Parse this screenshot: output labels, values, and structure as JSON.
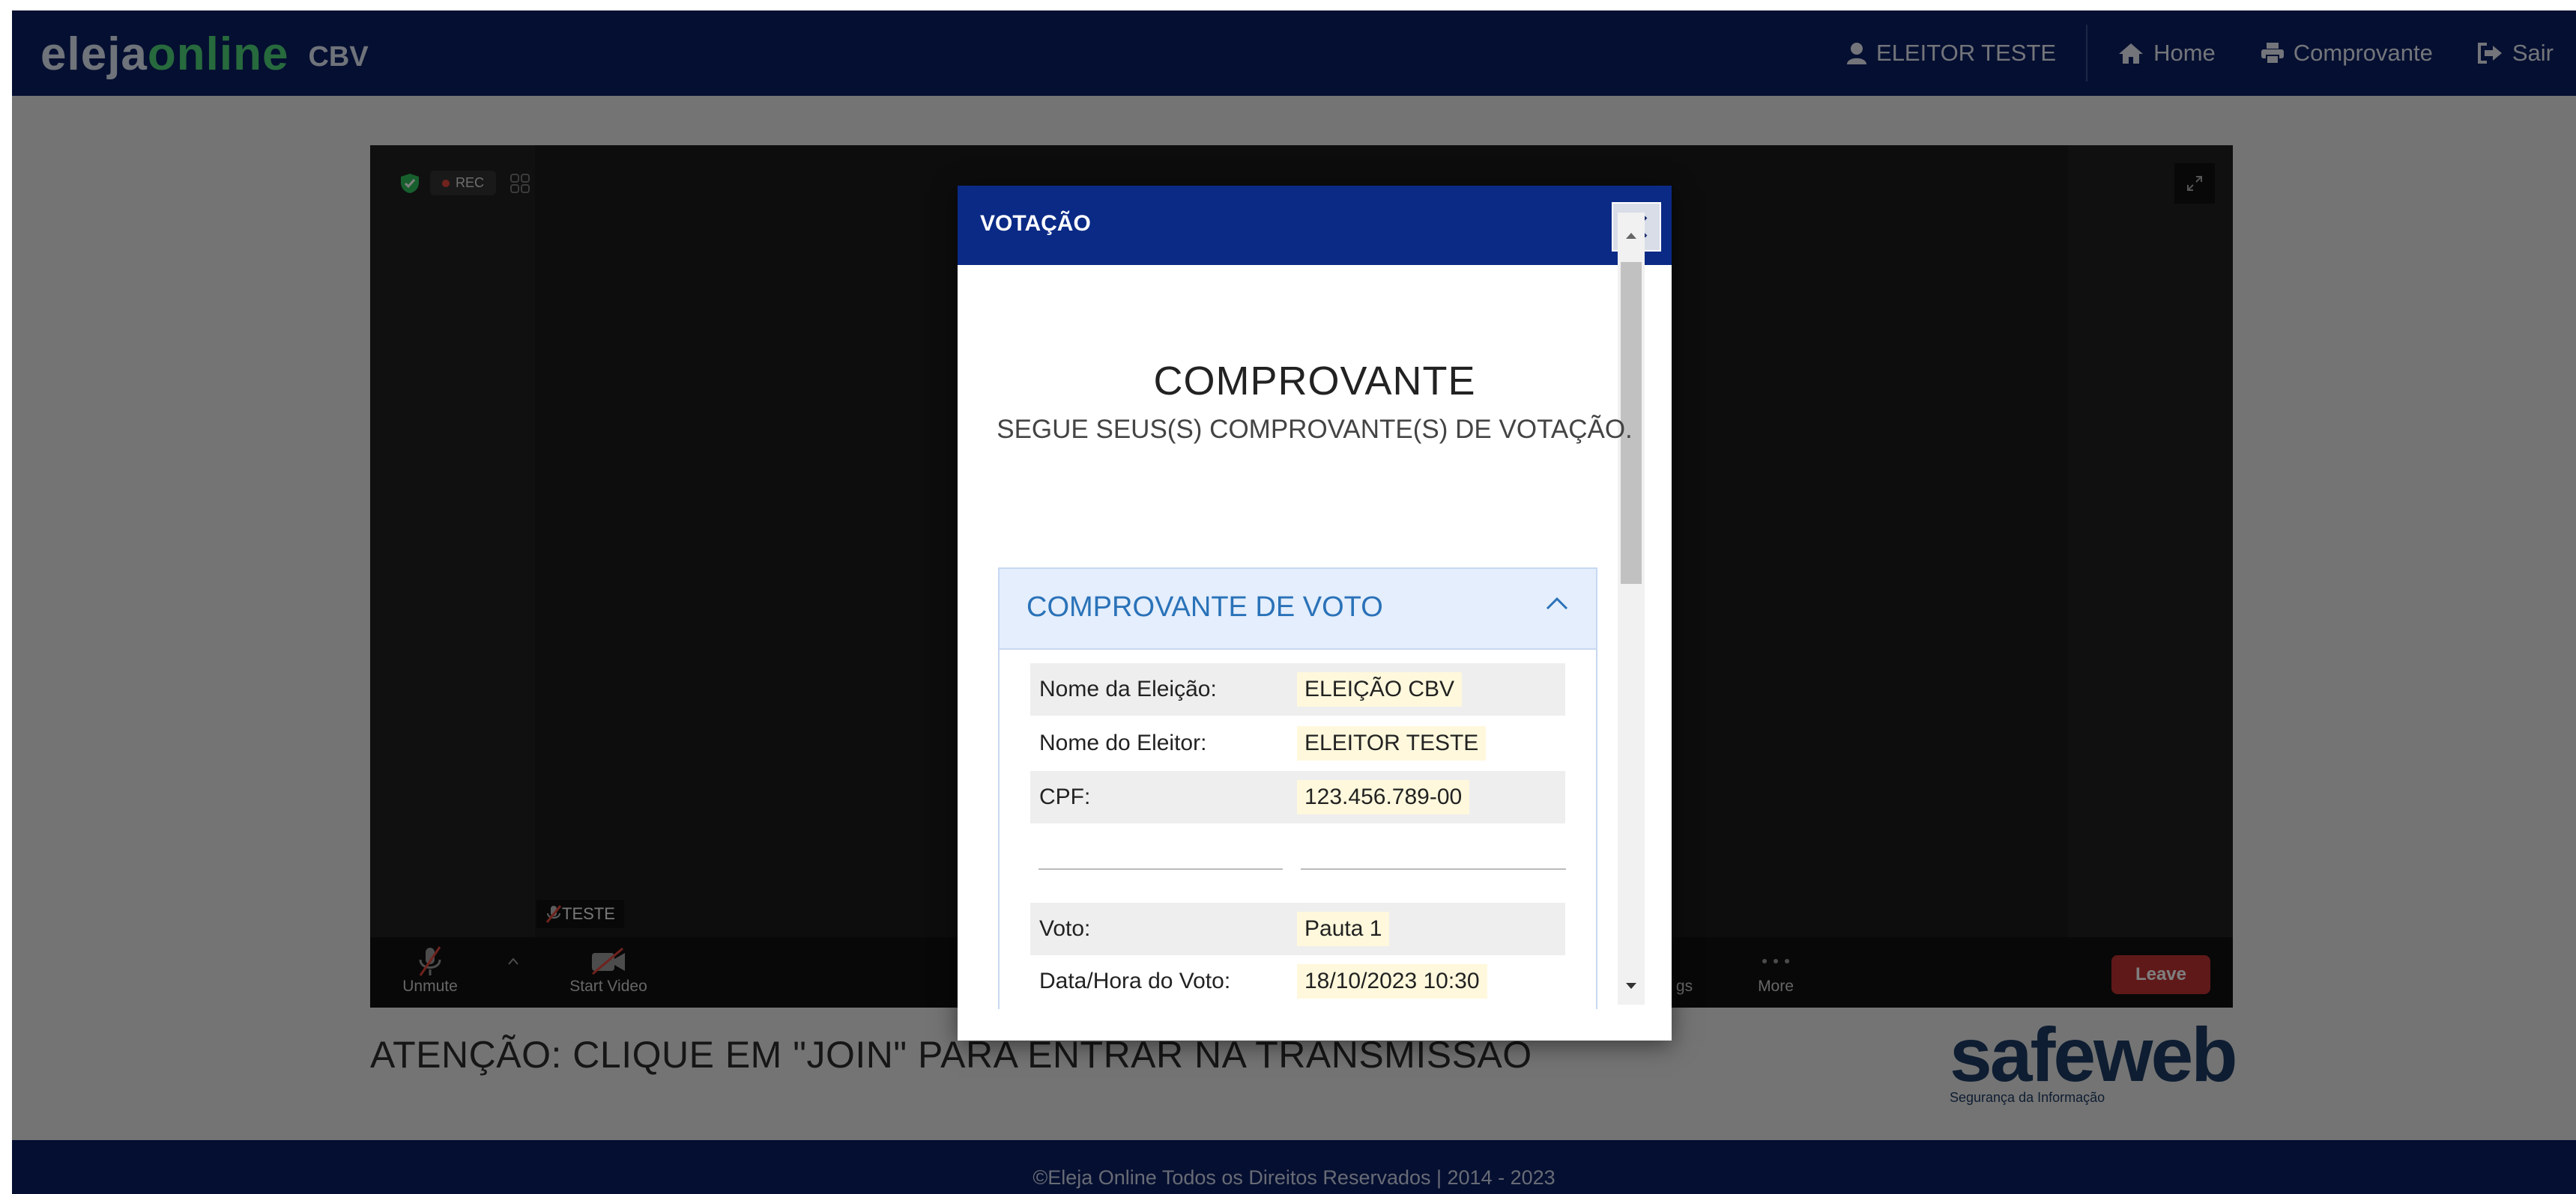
{
  "header": {
    "brand_part1": "eleja",
    "brand_part2": "online",
    "brand_sub": "CBV",
    "nav": {
      "user": "ELEITOR TESTE",
      "home": "Home",
      "receipt": "Comprovante",
      "exit": "Sair"
    }
  },
  "meeting": {
    "rec_label": "REC",
    "participant_name": "TESTE",
    "controls": {
      "unmute": "Unmute",
      "start_video": "Start Video",
      "settings_partial": "gs",
      "more": "More",
      "leave": "Leave"
    }
  },
  "notice": "ATENÇÃO: CLIQUE EM \"JOIN\" PARA ENTRAR NA TRANSMISSÃO",
  "partner_logo": {
    "word": "safeweb",
    "tagline": "Segurança da Informação"
  },
  "footer": "©Eleja Online Todos os Direitos Reservados  |  2014 - 2023",
  "modal": {
    "title": "VOTAÇÃO",
    "heading": "COMPROVANTE",
    "subheading": "SEGUE SEUS(S) COMPROVANTE(S) DE VOTAÇÃO.",
    "accordion_title": "COMPROVANTE DE VOTO",
    "rows": [
      {
        "label": "Nome da Eleição:",
        "value": "ELEIÇÃO CBV"
      },
      {
        "label": "Nome do Eleitor:",
        "value": "ELEITOR TESTE"
      },
      {
        "label": "CPF:",
        "value": "123.456.789-00"
      },
      {
        "label": "Voto:",
        "value": "Pauta 1"
      },
      {
        "label": "Data/Hora do Voto:",
        "value": "18/10/2023 10:30"
      }
    ]
  },
  "colors": {
    "navy": "#0a1e63",
    "modal_header": "#0a2a86",
    "brand_green": "#4fd47a",
    "accordion_bg": "#e4eefc",
    "accordion_text": "#2a72b8",
    "leave_red": "#c03333"
  }
}
